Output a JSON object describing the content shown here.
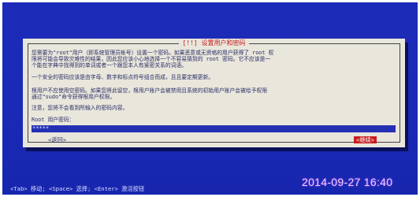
{
  "dialog": {
    "title": "[!!] 设置用户和密码",
    "paragraphs": [
      "您需要为\"root\"用户（即系统管理员帐号）设置一个密码。如果恶意或无资格的用户获得了 root 权",
      "限将可能会导致灾难性的结果，因此您应该小心地选择一个不容易猜到的 root 密码。它不应该是一",
      "个能在字典中找得到的单词或者一个跟您本人有紧密关系的词语。",
      "一个安全的密码应该是由字母、数字和标点符号组合而成，且且要定期更新。",
      "根用户不应使用空密码。如果您将此留空，根用户账户会被禁用且系统的初始用户账户会被给予权限",
      "通过\"sudo\"命令获得根用户权限。",
      "注意，您将不会看到所输入的密码内容。"
    ],
    "password_label": "Root 用户密码：",
    "password_value": "*****",
    "back_button": "<返回>",
    "continue_button": "<继续>"
  },
  "status_bar": "<Tab> 移动; <Space> 选择; <Enter> 激活按钮",
  "photo_timestamp": "2014-09-27 16:40",
  "colors": {
    "background": "#1c2bb8",
    "dialog_bg": "#e9e6dc",
    "title": "#c81d1d",
    "field": "#2430b4",
    "accent_button": "#c81d1d"
  }
}
